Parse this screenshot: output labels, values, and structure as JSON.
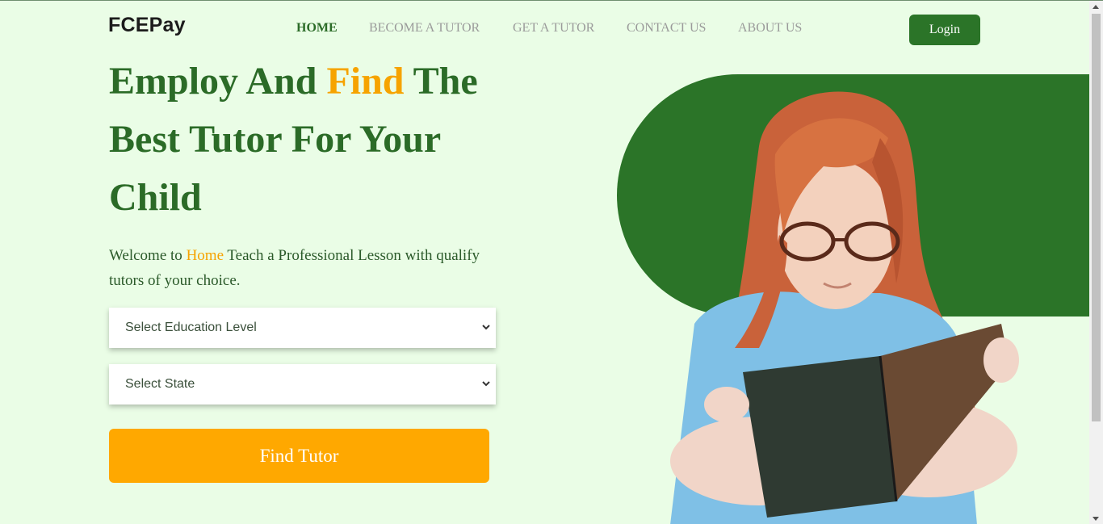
{
  "brand": {
    "logo_text": "FCEPay"
  },
  "nav": {
    "items": [
      {
        "label": "HOME",
        "active": true
      },
      {
        "label": "BECOME A TUTOR",
        "active": false
      },
      {
        "label": "GET A TUTOR",
        "active": false
      },
      {
        "label": "CONTACT US",
        "active": false
      },
      {
        "label": "ABOUT US",
        "active": false
      }
    ],
    "login_label": "Login"
  },
  "hero": {
    "title_part1": "Employ And ",
    "title_accent": "Find",
    "title_part2": " The Best Tutor For Your Child",
    "subtitle_part1": "Welcome to ",
    "subtitle_accent": "Home",
    "subtitle_part2": " Teach a Professional Lesson with qualify tutors of your choice."
  },
  "form": {
    "education_level": {
      "selected": "Select Education Level"
    },
    "state": {
      "selected": "Select State"
    },
    "submit_label": "Find Tutor"
  },
  "colors": {
    "primary_green": "#2b7428",
    "heading_green": "#2b6b27",
    "accent_orange": "#f6a300",
    "button_orange": "#ffa800",
    "background": "#eafde6"
  },
  "icons": {
    "select_chevron": "chevron-down-icon"
  }
}
